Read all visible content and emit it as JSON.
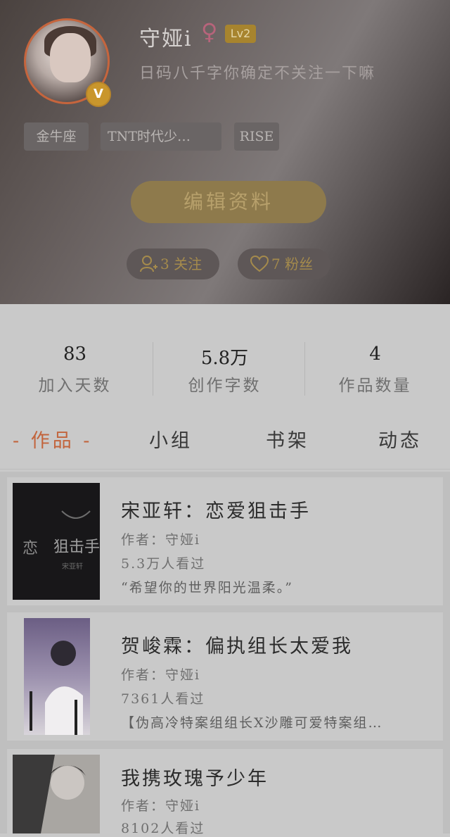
{
  "profile": {
    "username": "守娅i",
    "gender_icon": "♀",
    "level": "Lv2",
    "signature": "日码八千字你确定不关注一下嘛",
    "vip_badge": "V",
    "tags": [
      "金牛座",
      "TNT时代少…",
      "RISE"
    ],
    "edit_button": "编辑资料",
    "following": "3 关注",
    "fans": "7 粉丝"
  },
  "stats": [
    {
      "value": "83",
      "label": "加入天数"
    },
    {
      "value": "5.8万",
      "label": "创作字数"
    },
    {
      "value": "4",
      "label": "作品数量"
    }
  ],
  "tabs": [
    {
      "label": "- 作品 -",
      "active": true
    },
    {
      "label": "小组",
      "active": false
    },
    {
      "label": "书架",
      "active": false
    },
    {
      "label": "动态",
      "active": false
    }
  ],
  "works": [
    {
      "title": "宋亚轩：恋爱狙击手",
      "author": "作者：守娅i",
      "views": "5.3万人看过",
      "desc": "“希望你的世界阳光温柔。”"
    },
    {
      "title": "贺峻霖：偏执组长太爱我",
      "author": "作者：守娅i",
      "views": "7361人看过",
      "desc": "【伪高冷特案组组长X沙雕可爱特案组…"
    },
    {
      "title": "我携玫瑰予少年",
      "author": "作者：守娅i",
      "views": "8102人看过",
      "desc": ""
    }
  ],
  "colors": {
    "accent": "#c2643c",
    "gold": "#a7842e"
  }
}
